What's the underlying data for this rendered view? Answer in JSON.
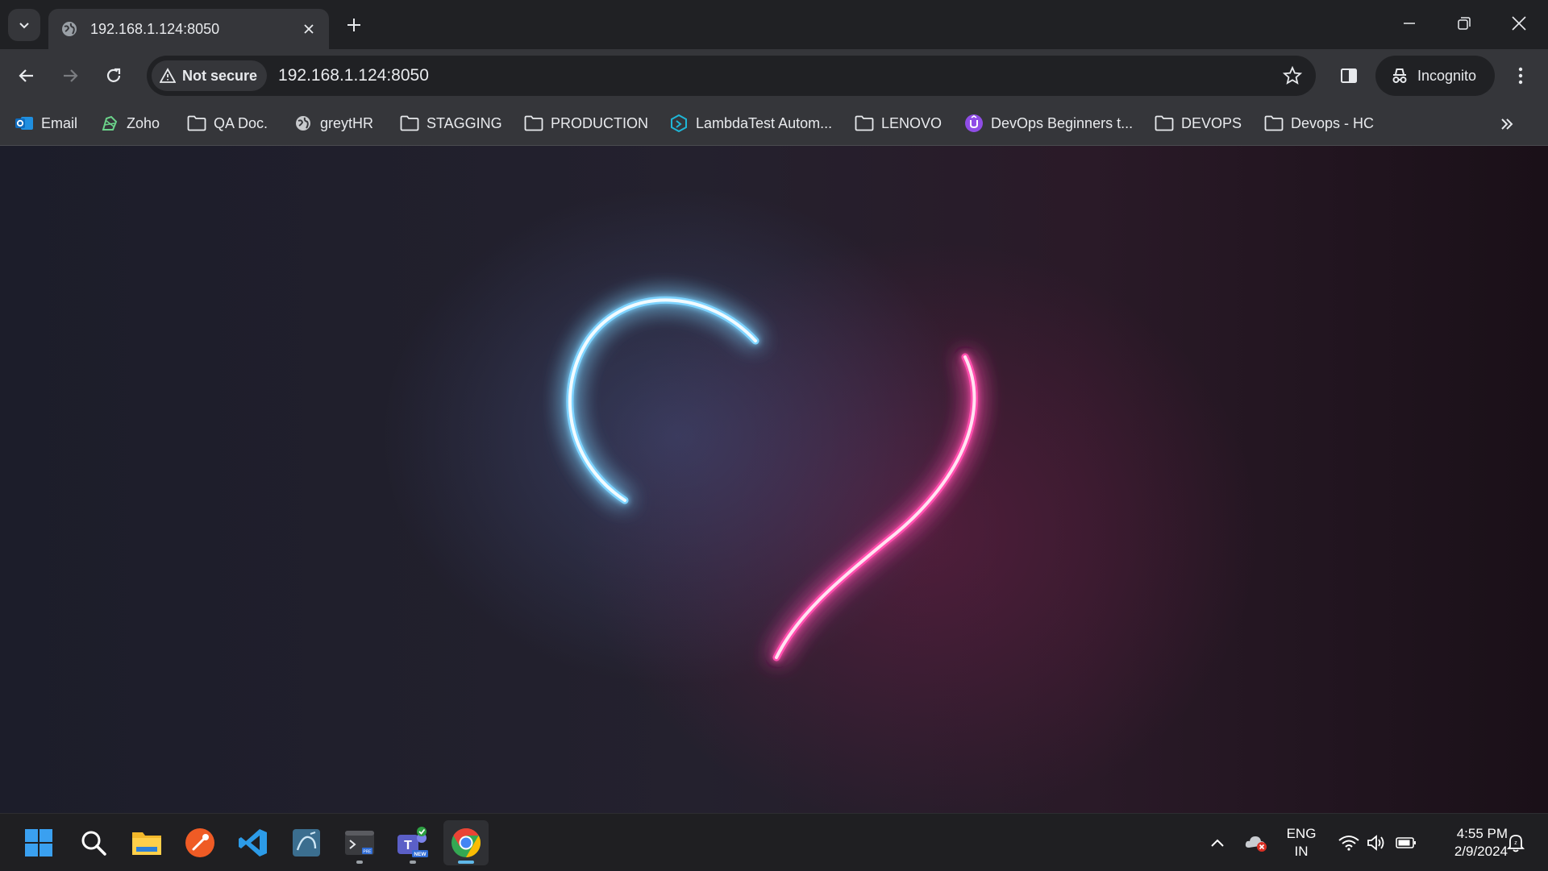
{
  "tab": {
    "title": "192.168.1.124:8050",
    "favicon": "globe-icon"
  },
  "address_bar": {
    "security_label": "Not secure",
    "url": "192.168.1.124:8050"
  },
  "profile": {
    "label": "Incognito"
  },
  "bookmarks": [
    {
      "label": "Email",
      "icon": "outlook-icon"
    },
    {
      "label": "Zoho",
      "icon": "zoho-icon"
    },
    {
      "label": "QA Doc.",
      "icon": "folder-icon"
    },
    {
      "label": "greytHR",
      "icon": "globe-icon"
    },
    {
      "label": "STAGGING",
      "icon": "folder-icon"
    },
    {
      "label": "PRODUCTION",
      "icon": "folder-icon"
    },
    {
      "label": "LambdaTest Autom...",
      "icon": "lambdatest-icon"
    },
    {
      "label": "LENOVO",
      "icon": "folder-icon"
    },
    {
      "label": "DevOps Beginners t...",
      "icon": "udemy-icon"
    },
    {
      "label": "DEVOPS",
      "icon": "folder-icon"
    },
    {
      "label": "Devops - HC",
      "icon": "folder-icon"
    }
  ],
  "page": {
    "visual": "neon-broken-heart",
    "colors": {
      "left_stroke": "#7fd4ff",
      "right_stroke": "#ff4fae"
    }
  },
  "taskbar": {
    "apps": [
      "windows-start-icon",
      "search-icon",
      "file-explorer-icon",
      "postman-icon",
      "vscode-icon",
      "mysql-workbench-icon",
      "terminal-preview-icon",
      "teams-new-icon",
      "chrome-icon"
    ],
    "language": {
      "line1": "ENG",
      "line2": "IN"
    },
    "time": "4:55 PM",
    "date": "2/9/2024"
  },
  "colors": {
    "tab_strip": "#202124",
    "toolbar": "#35363a",
    "accent": "#5fb8e8"
  }
}
